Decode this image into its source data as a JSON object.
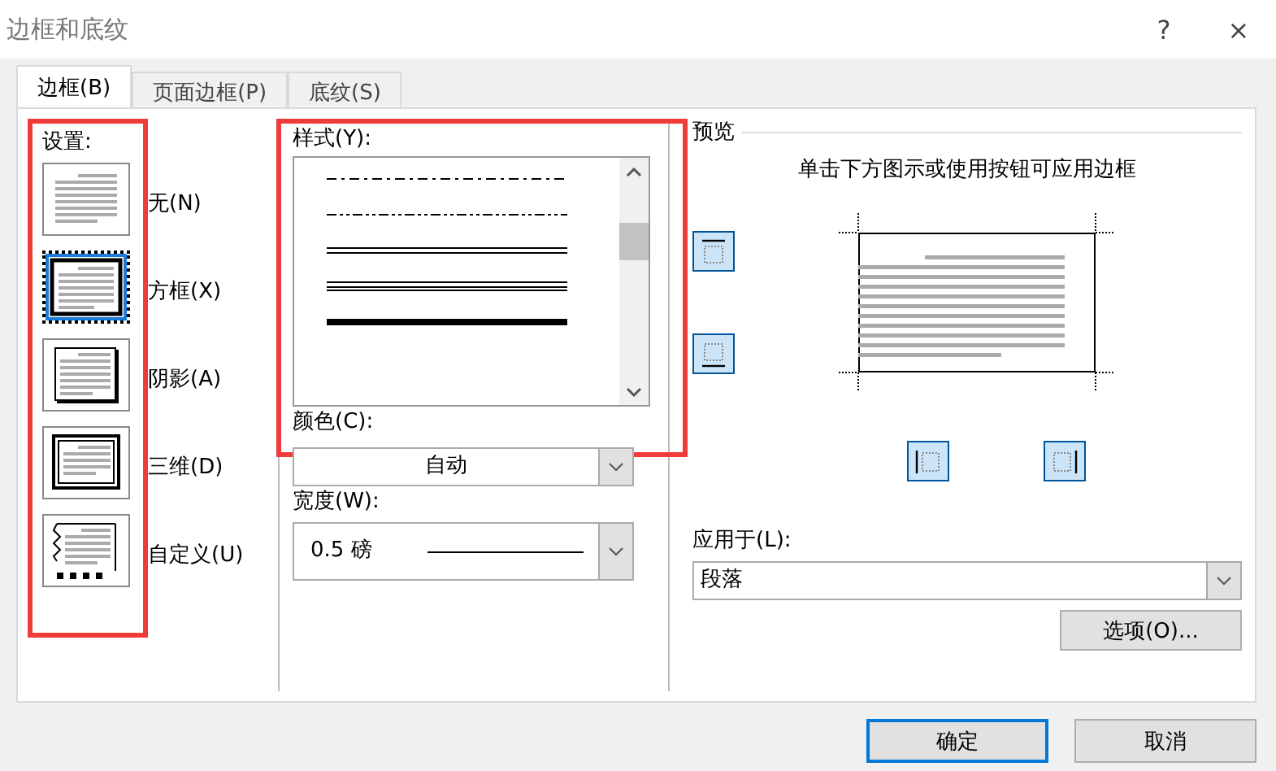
{
  "window": {
    "title": "边框和底纹",
    "help": "?",
    "close": "×"
  },
  "tabs": [
    {
      "label": "边框(B)",
      "selected": true
    },
    {
      "label": "页面边框(P)",
      "selected": false
    },
    {
      "label": "底纹(S)",
      "selected": false
    }
  ],
  "settings": {
    "label": "设置:",
    "highlighted": true,
    "options": [
      {
        "kind": "none",
        "label": "无(N)",
        "selected": false
      },
      {
        "kind": "box",
        "label": "方框(X)",
        "selected": true
      },
      {
        "kind": "shadow",
        "label": "阴影(A)",
        "selected": false
      },
      {
        "kind": "threed",
        "label": "三维(D)",
        "selected": false
      },
      {
        "kind": "custom",
        "label": "自定义(U)",
        "selected": false
      }
    ]
  },
  "style": {
    "label": "样式(Y):",
    "highlighted": true,
    "lines": [
      {
        "kind": "dashdot",
        "selected": false
      },
      {
        "kind": "dashdotdot",
        "selected": false
      },
      {
        "kind": "double",
        "selected": false
      },
      {
        "kind": "triple",
        "selected": false
      },
      {
        "kind": "thick",
        "selected": false
      }
    ]
  },
  "color": {
    "label": "颜色(C):",
    "value": "自动"
  },
  "width": {
    "label": "宽度(W):",
    "value": "0.5 磅"
  },
  "preview": {
    "title": "预览",
    "hint": "单击下方图示或使用按钮可应用边框",
    "border_buttons": [
      {
        "kind": "top"
      },
      {
        "kind": "bottom"
      },
      {
        "kind": "left"
      },
      {
        "kind": "right"
      }
    ]
  },
  "apply_to": {
    "label": "应用于(L):",
    "value": "段落"
  },
  "options_button": "选项(O)...",
  "buttons": [
    {
      "label": "确定",
      "selected": true
    },
    {
      "label": "取消",
      "selected": false
    }
  ]
}
